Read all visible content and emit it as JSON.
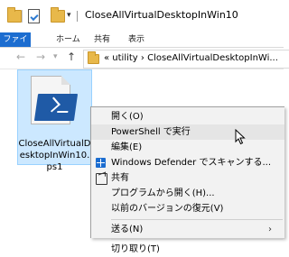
{
  "window": {
    "title": "CloseAllVirtualDesktopInWin10"
  },
  "ribbon": {
    "tabs": [
      "ファイル",
      "ホーム",
      "共有",
      "表示"
    ]
  },
  "address": {
    "path": "«  utility  ›  CloseAllVirtualDesktopInWi..."
  },
  "file": {
    "name_lines": [
      "CloseAllVirtualD",
      "esktopInWin10.",
      "ps1"
    ],
    "icon": "powershell-script-icon"
  },
  "context_menu": {
    "items": [
      {
        "label": "開く(O)"
      },
      {
        "label": "PowerShell で実行",
        "highlighted": true
      },
      {
        "label": "編集(E)"
      },
      {
        "label": "Windows Defender でスキャンする...",
        "icon": "windows-defender-icon"
      },
      {
        "label": "共有",
        "icon": "share-icon"
      },
      {
        "label": "プログラムから開く(H)..."
      },
      {
        "label": "以前のバージョンの復元(V)"
      },
      {
        "label": "送る(N)",
        "has_submenu": true
      },
      {
        "label": "切り取り(T)"
      }
    ]
  },
  "colors": {
    "accent": "#1c6dd0",
    "selection": "#cce8ff",
    "menu_bg": "#f2f2f2"
  }
}
